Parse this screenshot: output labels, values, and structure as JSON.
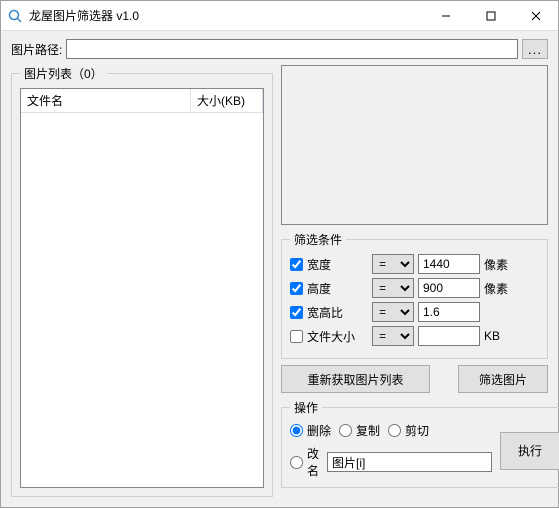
{
  "titlebar": {
    "title": "龙屋图片筛选器 v1.0",
    "min": "–",
    "max": "□",
    "close": "✕"
  },
  "path": {
    "label": "图片路径:",
    "value": "",
    "browse": "..."
  },
  "list": {
    "legend": "图片列表（0）",
    "col_name": "文件名",
    "col_size": "大小(KB)"
  },
  "filter": {
    "legend": "筛选条件",
    "width": {
      "label": "宽度",
      "checked": true,
      "op": "=",
      "value": "1440",
      "unit": "像素"
    },
    "height": {
      "label": "高度",
      "checked": true,
      "op": "=",
      "value": "900",
      "unit": "像素"
    },
    "aspect": {
      "label": "宽高比",
      "checked": true,
      "op": "=",
      "value": "1.6",
      "unit": ""
    },
    "filesize": {
      "label": "文件大小",
      "checked": false,
      "op": "=",
      "value": "",
      "unit": "KB"
    }
  },
  "actions": {
    "refresh": "重新获取图片列表",
    "dofilter": "筛选图片"
  },
  "ops": {
    "legend": "操作",
    "delete": "删除",
    "copy": "复制",
    "cut": "剪切",
    "rename": "改名",
    "rename_template": "图片[i]",
    "exec": "执行",
    "selected": "delete"
  }
}
